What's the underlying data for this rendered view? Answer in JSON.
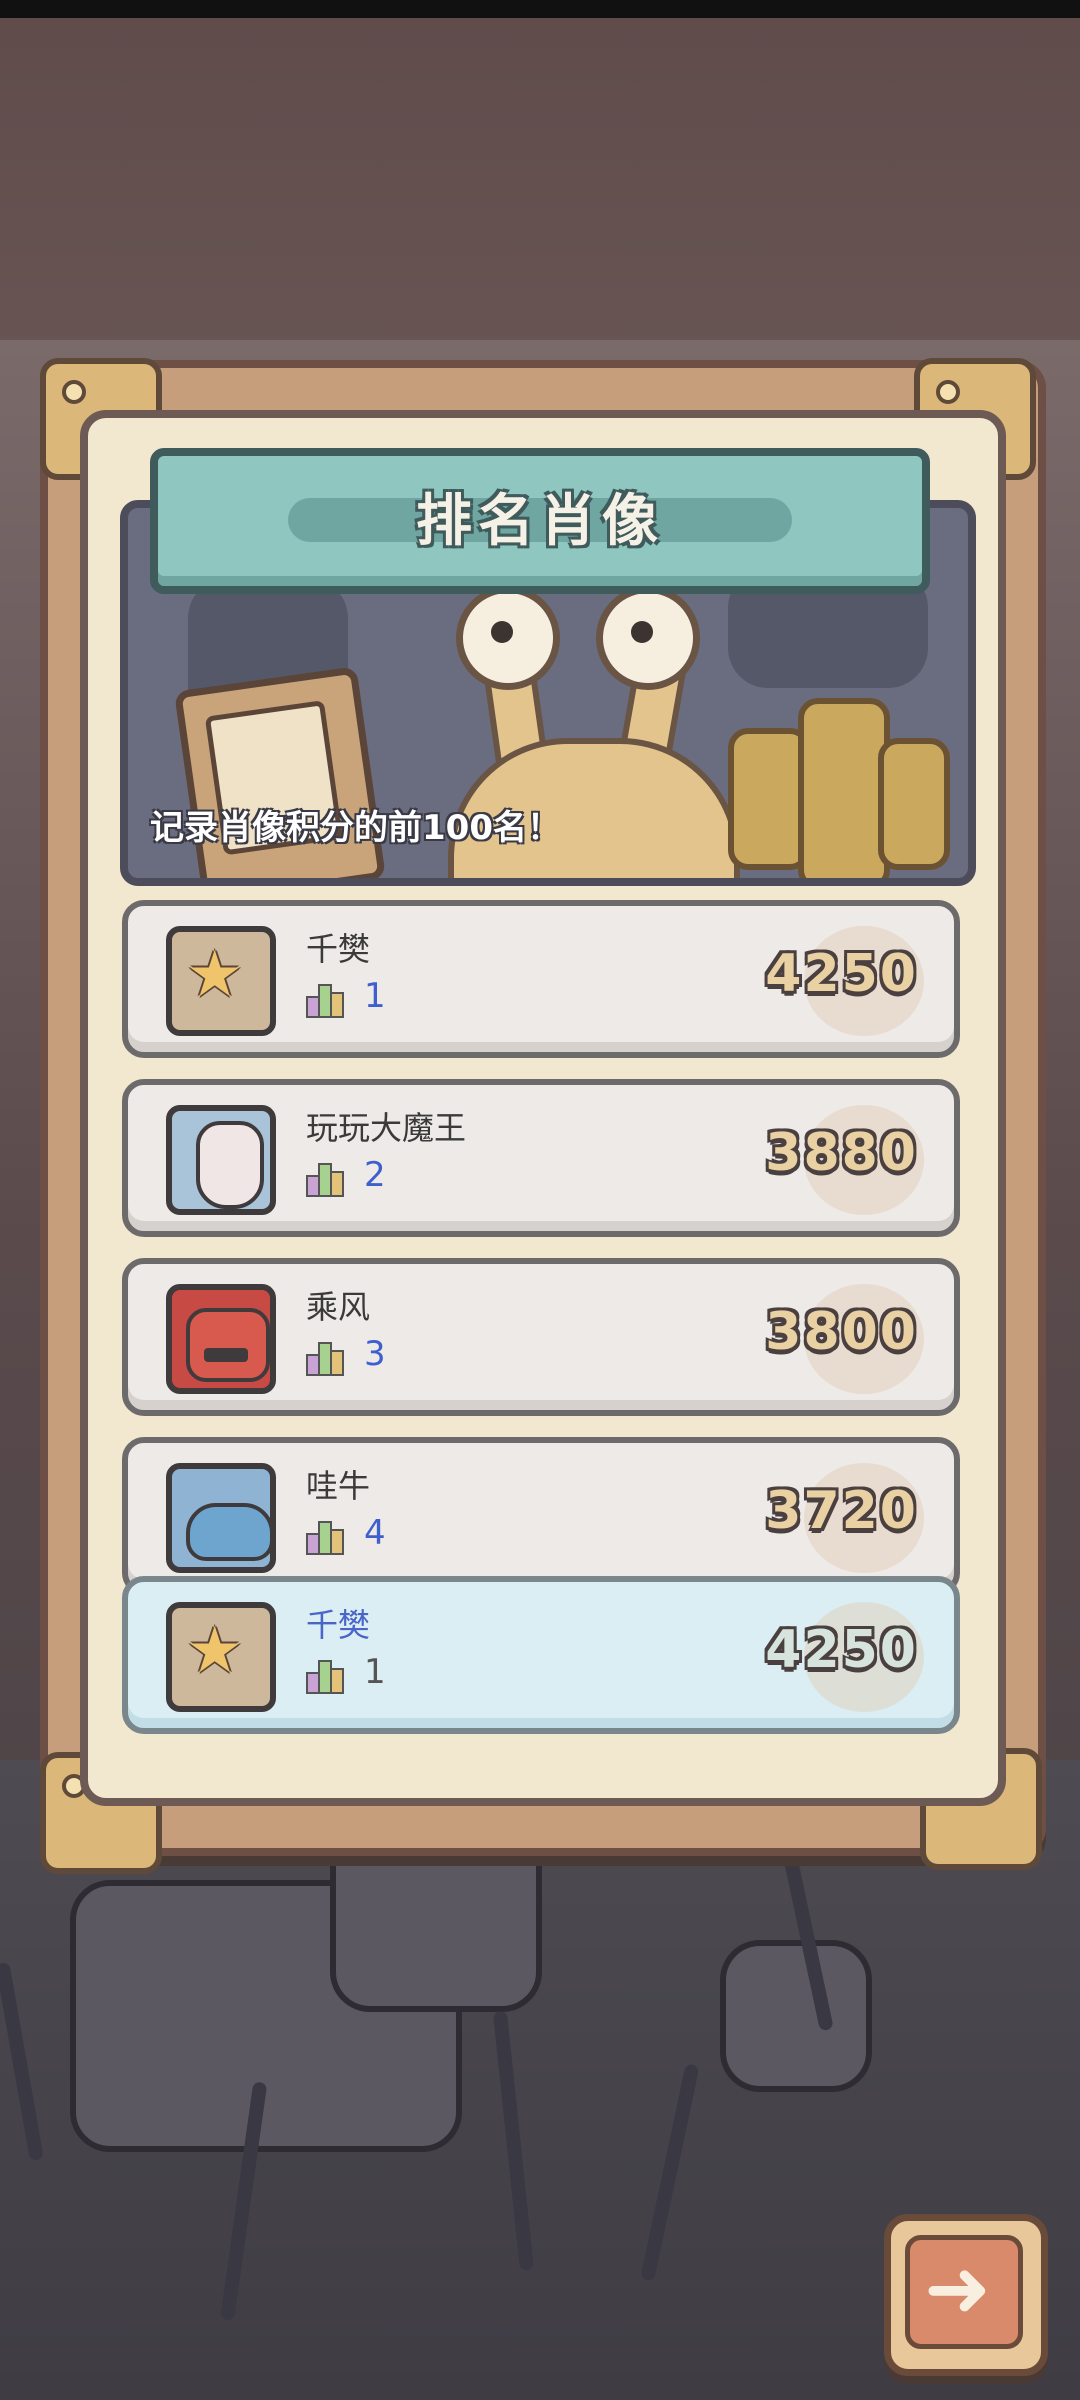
{
  "header": {
    "title": "排名肖像",
    "subtitle": "记录肖像积分的前100名！"
  },
  "rankings": [
    {
      "name": "千樊",
      "rank": "1",
      "score": "4250",
      "avatar_icon": "star-trophy-icon"
    },
    {
      "name": "玩玩大魔王",
      "rank": "2",
      "score": "3880",
      "avatar_icon": "demon-face-icon"
    },
    {
      "name": "乘风",
      "rank": "3",
      "score": "3800",
      "avatar_icon": "red-monster-icon"
    },
    {
      "name": "哇牛",
      "rank": "4",
      "score": "3720",
      "avatar_icon": "fish-monster-icon"
    }
  ],
  "my_entry": {
    "name": "千樊",
    "rank": "1",
    "score": "4250",
    "avatar_icon": "star-trophy-icon"
  },
  "buttons": {
    "next_icon": "right-arrow-icon"
  },
  "colors": {
    "board": "#c79e7b",
    "title_plate": "#8fc7c0",
    "rank_number": "#3f5fcf",
    "my_row": "#dbeef4"
  }
}
